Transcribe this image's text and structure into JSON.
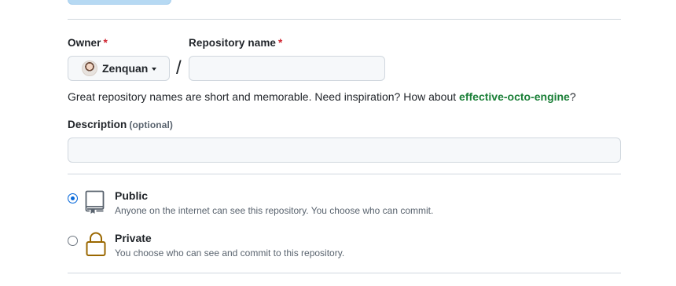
{
  "owner": {
    "label": "Owner",
    "required_mark": "*",
    "selected": "Zenquan"
  },
  "repository_name": {
    "label": "Repository name",
    "required_mark": "*",
    "value": "",
    "separator": "/"
  },
  "name_hint": {
    "text": "Great repository names are short and memorable. Need inspiration? How about ",
    "suggestion": "effective-octo-engine",
    "suffix": "?"
  },
  "description": {
    "label": "Description",
    "optional": "(optional)",
    "value": ""
  },
  "visibility": {
    "selected": "public",
    "options": [
      {
        "title": "Public",
        "description": "Anyone on the internet can see this repository. You choose who can commit.",
        "icon": "repo-icon"
      },
      {
        "title": "Private",
        "description": "You choose who can see and commit to this repository.",
        "icon": "lock-icon"
      }
    ]
  },
  "colors": {
    "accent": "#0969da",
    "required": "#cf222e",
    "suggestion": "#1a7f37",
    "private_icon": "#9a6700",
    "border": "#d0d7de"
  }
}
